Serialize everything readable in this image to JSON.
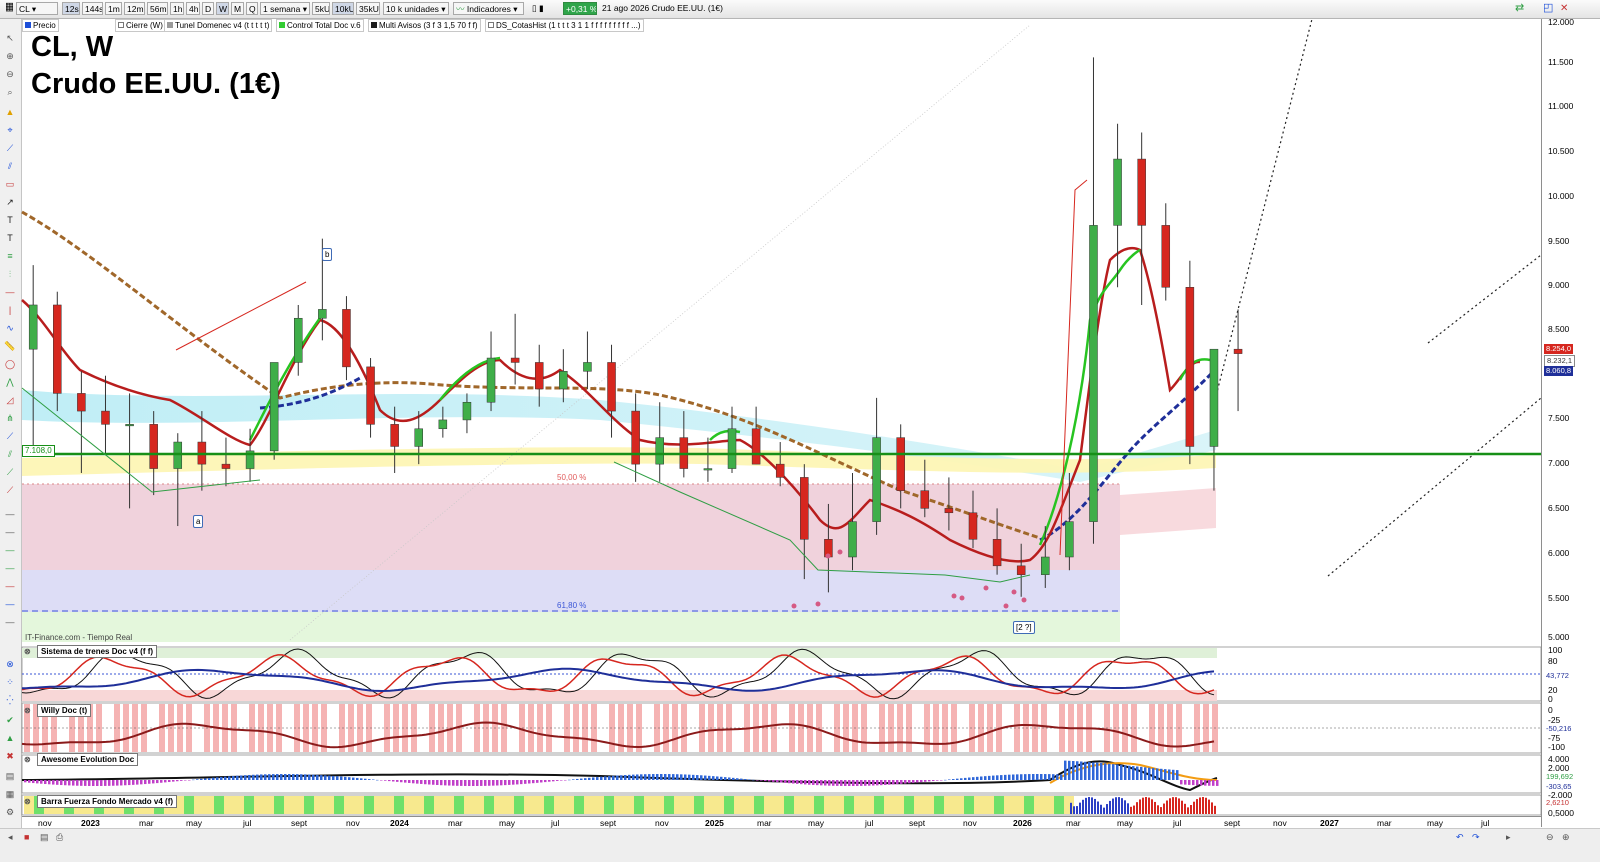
{
  "toolbar": {
    "symbol": "CL",
    "timeframes": [
      "12s",
      "144s",
      "1m",
      "12m",
      "56m",
      "1h",
      "4h",
      "D",
      "W",
      "M",
      "Q"
    ],
    "active_timeframe": "W",
    "period": "1 semana",
    "units": [
      "5kU",
      "10kU",
      "35kU"
    ],
    "active_unit": "10kU",
    "unit_mode": "10 k unidades",
    "indicators_label": "Indicadores",
    "change": "+0,31 %",
    "date_title": "21 ago 2026  Crudo EE.UU. (1€)"
  },
  "indicators": [
    {
      "label": "Precio",
      "color": "#1d4fd8"
    },
    {
      "label": "Cierre (W)",
      "color": "#ffffff"
    },
    {
      "label": "Tunel Domenec v4 (t t t t t)",
      "color": "#9a9a9a"
    },
    {
      "label": "Control Total Doc v.6",
      "color": "#33cc33"
    },
    {
      "label": "Multi Avisos (3 f 3 1,5 70 f f)",
      "color": "#1c1c1c"
    },
    {
      "label": "DS_CotasHist (1 t t t 3 1 1 f f f f f f f f f ...)",
      "color": "#ffffff"
    }
  ],
  "chart": {
    "title_line1": "CL, W",
    "title_line2": "Crudo EE.UU. (1€)",
    "source": "IT-Finance.com - Tiempo Real",
    "level_label": "7.108,0",
    "fib_50": "50,00 %",
    "fib_618": "61,80 %",
    "annotations": {
      "a": "a",
      "b": "b",
      "c": "[2 ?]"
    }
  },
  "price_axis": {
    "ticks": [
      "12.000",
      "11.500",
      "11.000",
      "10.500",
      "10.000",
      "9.500",
      "9.000",
      "8.500",
      "8.000",
      "7.500",
      "7.000",
      "6.500",
      "6.000",
      "5.500",
      "5.000"
    ],
    "markers": [
      {
        "value": "8.254,0",
        "color": "#d6271f"
      },
      {
        "value": "8.232,1",
        "color": "#8a8a8a"
      },
      {
        "value": "8.060,8",
        "color": "#1f2f99"
      }
    ]
  },
  "chart_data": {
    "type": "candlestick",
    "title": "CL, W",
    "subtitle": "Crudo EE.UU. (1€)",
    "ylim": [
      5000,
      12000
    ],
    "x": [
      "2022-10-14",
      "2022-11-11",
      "2022-12-09",
      "2023-01-06",
      "2023-02-03",
      "2023-03-03",
      "2023-03-31",
      "2023-04-28",
      "2023-05-26",
      "2023-06-23",
      "2023-07-21",
      "2023-08-18",
      "2023-09-15",
      "2023-10-13",
      "2023-11-10",
      "2023-12-08",
      "2024-01-05",
      "2024-02-02",
      "2024-03-01",
      "2024-03-29",
      "2024-04-26",
      "2024-05-24",
      "2024-06-21",
      "2024-07-19",
      "2024-08-16",
      "2024-09-13",
      "2024-10-11",
      "2024-11-08",
      "2024-12-06",
      "2025-01-03",
      "2025-01-31",
      "2025-02-28",
      "2025-03-28",
      "2025-04-25",
      "2025-05-23",
      "2025-06-20",
      "2025-07-18",
      "2025-08-15",
      "2025-09-12",
      "2025-10-10",
      "2025-11-07",
      "2025-12-05",
      "2026-01-02",
      "2026-01-30",
      "2026-02-27",
      "2026-03-27",
      "2026-04-24",
      "2026-05-22",
      "2026-06-19",
      "2026-07-17",
      "2026-08-14"
    ],
    "open": [
      8300,
      8800,
      7800,
      7600,
      7450,
      7450,
      6950,
      7250,
      7000,
      6950,
      7150,
      8150,
      8650,
      8750,
      8100,
      7450,
      7200,
      7400,
      7500,
      7700,
      8200,
      8150,
      7850,
      8050,
      8150,
      7600,
      7000,
      7300,
      6950,
      6950,
      7400,
      7000,
      6850,
      6150,
      5950,
      6350,
      7300,
      6700,
      6500,
      6450,
      6150,
      5850,
      5750,
      5950,
      6350,
      9700,
      10450,
      9700,
      9000,
      7200,
      8300
    ],
    "high": [
      9250,
      8950,
      8050,
      8000,
      7800,
      7600,
      7350,
      7600,
      7300,
      7400,
      8100,
      8800,
      9550,
      8900,
      8200,
      7650,
      7600,
      7650,
      7800,
      8500,
      8700,
      8350,
      8300,
      8500,
      8350,
      7800,
      7700,
      7600,
      7300,
      7650,
      7650,
      7250,
      7000,
      6550,
      6900,
      7750,
      7450,
      7050,
      6850,
      6700,
      6500,
      6100,
      6300,
      6900,
      11600,
      10850,
      10750,
      9950,
      9300,
      7800,
      8750
    ],
    "low": [
      7200,
      7600,
      6900,
      7100,
      6500,
      6650,
      6300,
      6700,
      6750,
      6800,
      7050,
      8000,
      8400,
      7950,
      7300,
      6900,
      7000,
      7300,
      7350,
      7600,
      7900,
      7650,
      7700,
      7850,
      7300,
      6800,
      6800,
      6850,
      6800,
      6900,
      7000,
      6750,
      5700,
      5550,
      5800,
      6200,
      6500,
      6400,
      6250,
      6050,
      5750,
      5500,
      5600,
      5800,
      6100,
      9000,
      8800,
      8850,
      7000,
      6700,
      7600
    ],
    "close": [
      8800,
      7800,
      7600,
      7450,
      7450,
      6950,
      7250,
      7000,
      6950,
      7150,
      8150,
      8650,
      8750,
      8100,
      7450,
      7200,
      7400,
      7500,
      7700,
      8200,
      8150,
      7850,
      8050,
      8150,
      7600,
      7000,
      7300,
      6950,
      6950,
      7400,
      7000,
      6850,
      6150,
      5950,
      6350,
      7300,
      6700,
      6500,
      6450,
      6150,
      5850,
      5750,
      5950,
      6350,
      9700,
      10450,
      9700,
      9000,
      7200,
      8300,
      8250
    ],
    "series": [
      {
        "name": "Cierre (W)",
        "values": [
          8800,
          7800,
          7600,
          7450,
          7450,
          6950,
          7250,
          7000,
          6950,
          7150,
          8150,
          8650,
          8750,
          8100,
          7450,
          7200,
          7400,
          7500,
          7700,
          8200,
          8150,
          7850,
          8050,
          8150,
          7600,
          7000,
          7300,
          6950,
          6950,
          7400,
          7000,
          6850,
          6150,
          5950,
          6350,
          7300,
          6700,
          6500,
          6450,
          6150,
          5850,
          5750,
          5950,
          6350,
          9700,
          10450,
          9700,
          9000,
          7200,
          8300,
          8250
        ]
      }
    ],
    "levels": [
      {
        "value": 7108,
        "label": "7.108,0"
      }
    ],
    "fibonacci": [
      {
        "label": "50,00 %"
      },
      {
        "label": "61,80 %",
        "value": 5350
      }
    ]
  },
  "subpanels": [
    {
      "label": "Sistema de trenes Doc v4 (f f)",
      "ticks": [
        "100",
        "80",
        "43,772",
        "20",
        "0"
      ]
    },
    {
      "label": "Willy Doc (t)",
      "ticks": [
        "0",
        "-25",
        "-50,216",
        "-75",
        "-100"
      ]
    },
    {
      "label": "Awesome Evolution Doc",
      "ticks": [
        "4.000",
        "2.000",
        "199,692",
        "-303,65",
        "-2.000"
      ]
    },
    {
      "label": "Barra Fuerza Fondo Mercado v4 (f)",
      "ticks": [
        "2,6210",
        "0,5000"
      ]
    }
  ],
  "date_axis": [
    {
      "label": "nov",
      "bold": false
    },
    {
      "label": "2023",
      "bold": true
    },
    {
      "label": "mar",
      "bold": false
    },
    {
      "label": "may",
      "bold": false
    },
    {
      "label": "jul",
      "bold": false
    },
    {
      "label": "sept",
      "bold": false
    },
    {
      "label": "nov",
      "bold": false
    },
    {
      "label": "2024",
      "bold": true
    },
    {
      "label": "mar",
      "bold": false
    },
    {
      "label": "may",
      "bold": false
    },
    {
      "label": "jul",
      "bold": false
    },
    {
      "label": "sept",
      "bold": false
    },
    {
      "label": "nov",
      "bold": false
    },
    {
      "label": "2025",
      "bold": true
    },
    {
      "label": "mar",
      "bold": false
    },
    {
      "label": "may",
      "bold": false
    },
    {
      "label": "jul",
      "bold": false
    },
    {
      "label": "sept",
      "bold": false
    },
    {
      "label": "nov",
      "bold": false
    },
    {
      "label": "2026",
      "bold": true
    },
    {
      "label": "mar",
      "bold": false
    },
    {
      "label": "may",
      "bold": false
    },
    {
      "label": "jul",
      "bold": false
    },
    {
      "label": "sept",
      "bold": false
    },
    {
      "label": "nov",
      "bold": false
    },
    {
      "label": "2027",
      "bold": true
    },
    {
      "label": "mar",
      "bold": false
    },
    {
      "label": "may",
      "bold": false
    },
    {
      "label": "jul",
      "bold": false
    }
  ],
  "colors": {
    "up": "#2f9e44",
    "down": "#d6271f",
    "level": "#178f17",
    "fib_bg": "#d7d7f3",
    "fib_top": "#f3c8cf"
  }
}
